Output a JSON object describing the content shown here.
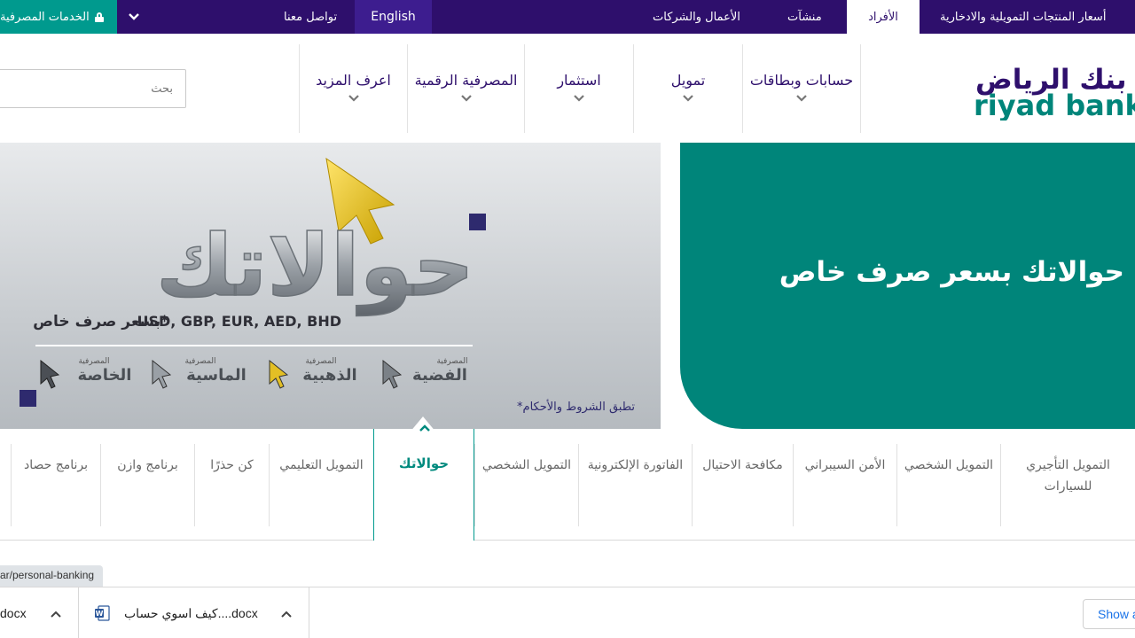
{
  "topbar": {
    "services_label": "الخدمات المصرفية",
    "contact_label": "تواصل معنا",
    "english_label": "English",
    "business_label": "الأعمال والشركات",
    "establishments_label": "منشآت",
    "individuals_label": "الأفراد",
    "rates_label": "أسعار المنتجات التمويلية والادخارية"
  },
  "header": {
    "search_placeholder": "بحث",
    "logo_text_ar": "بنك الرياض",
    "logo_text_en": "riyad bank",
    "nav": [
      {
        "label": "حسابات وبطاقات"
      },
      {
        "label": "تمويل"
      },
      {
        "label": "استثمار"
      },
      {
        "label": "المصرفية الرقمية"
      },
      {
        "label": "اعرف المزيد"
      }
    ]
  },
  "banner": {
    "title": "حوالاتك بسعر صرف خاص",
    "graphic_word": "حوالاتك",
    "currencies_line": "USD, GBP, EUR, AED, BHD",
    "special_rate": "بسعر صرف خاص*",
    "terms": "*تطبق الشروط والأحكام",
    "tiers": [
      {
        "small": "المصرفية",
        "name": "الفضية"
      },
      {
        "small": "المصرفية",
        "name": "الذهبية"
      },
      {
        "small": "المصرفية",
        "name": "الماسية"
      },
      {
        "small": "المصرفية",
        "name": "الخاصة"
      }
    ]
  },
  "categories": {
    "items": [
      {
        "label": "التمويل التأجيري للسيارات"
      },
      {
        "label": "التمويل الشخصي"
      },
      {
        "label": "الأمن السيبراني"
      },
      {
        "label": "مكافحة الاحتيال"
      },
      {
        "label": "الفاتورة الإلكترونية"
      },
      {
        "label": "التمويل الشخصي"
      },
      {
        "label": "التمويل التعليمي"
      },
      {
        "label": "كن حذرًا"
      },
      {
        "label": "برنامج وازن"
      },
      {
        "label": "برنامج حصاد"
      }
    ],
    "active_label": "حوالاتك"
  },
  "status": {
    "url": "ar/personal-banking"
  },
  "downloads": {
    "item1": "docx",
    "item2": "كيف اسوي حساب....docx",
    "show_all": "Show all"
  },
  "colors": {
    "brand_purple": "#2e0f6c",
    "brand_teal": "#00857a",
    "accent_teal": "#009a8e",
    "gold": "#f5c400"
  }
}
